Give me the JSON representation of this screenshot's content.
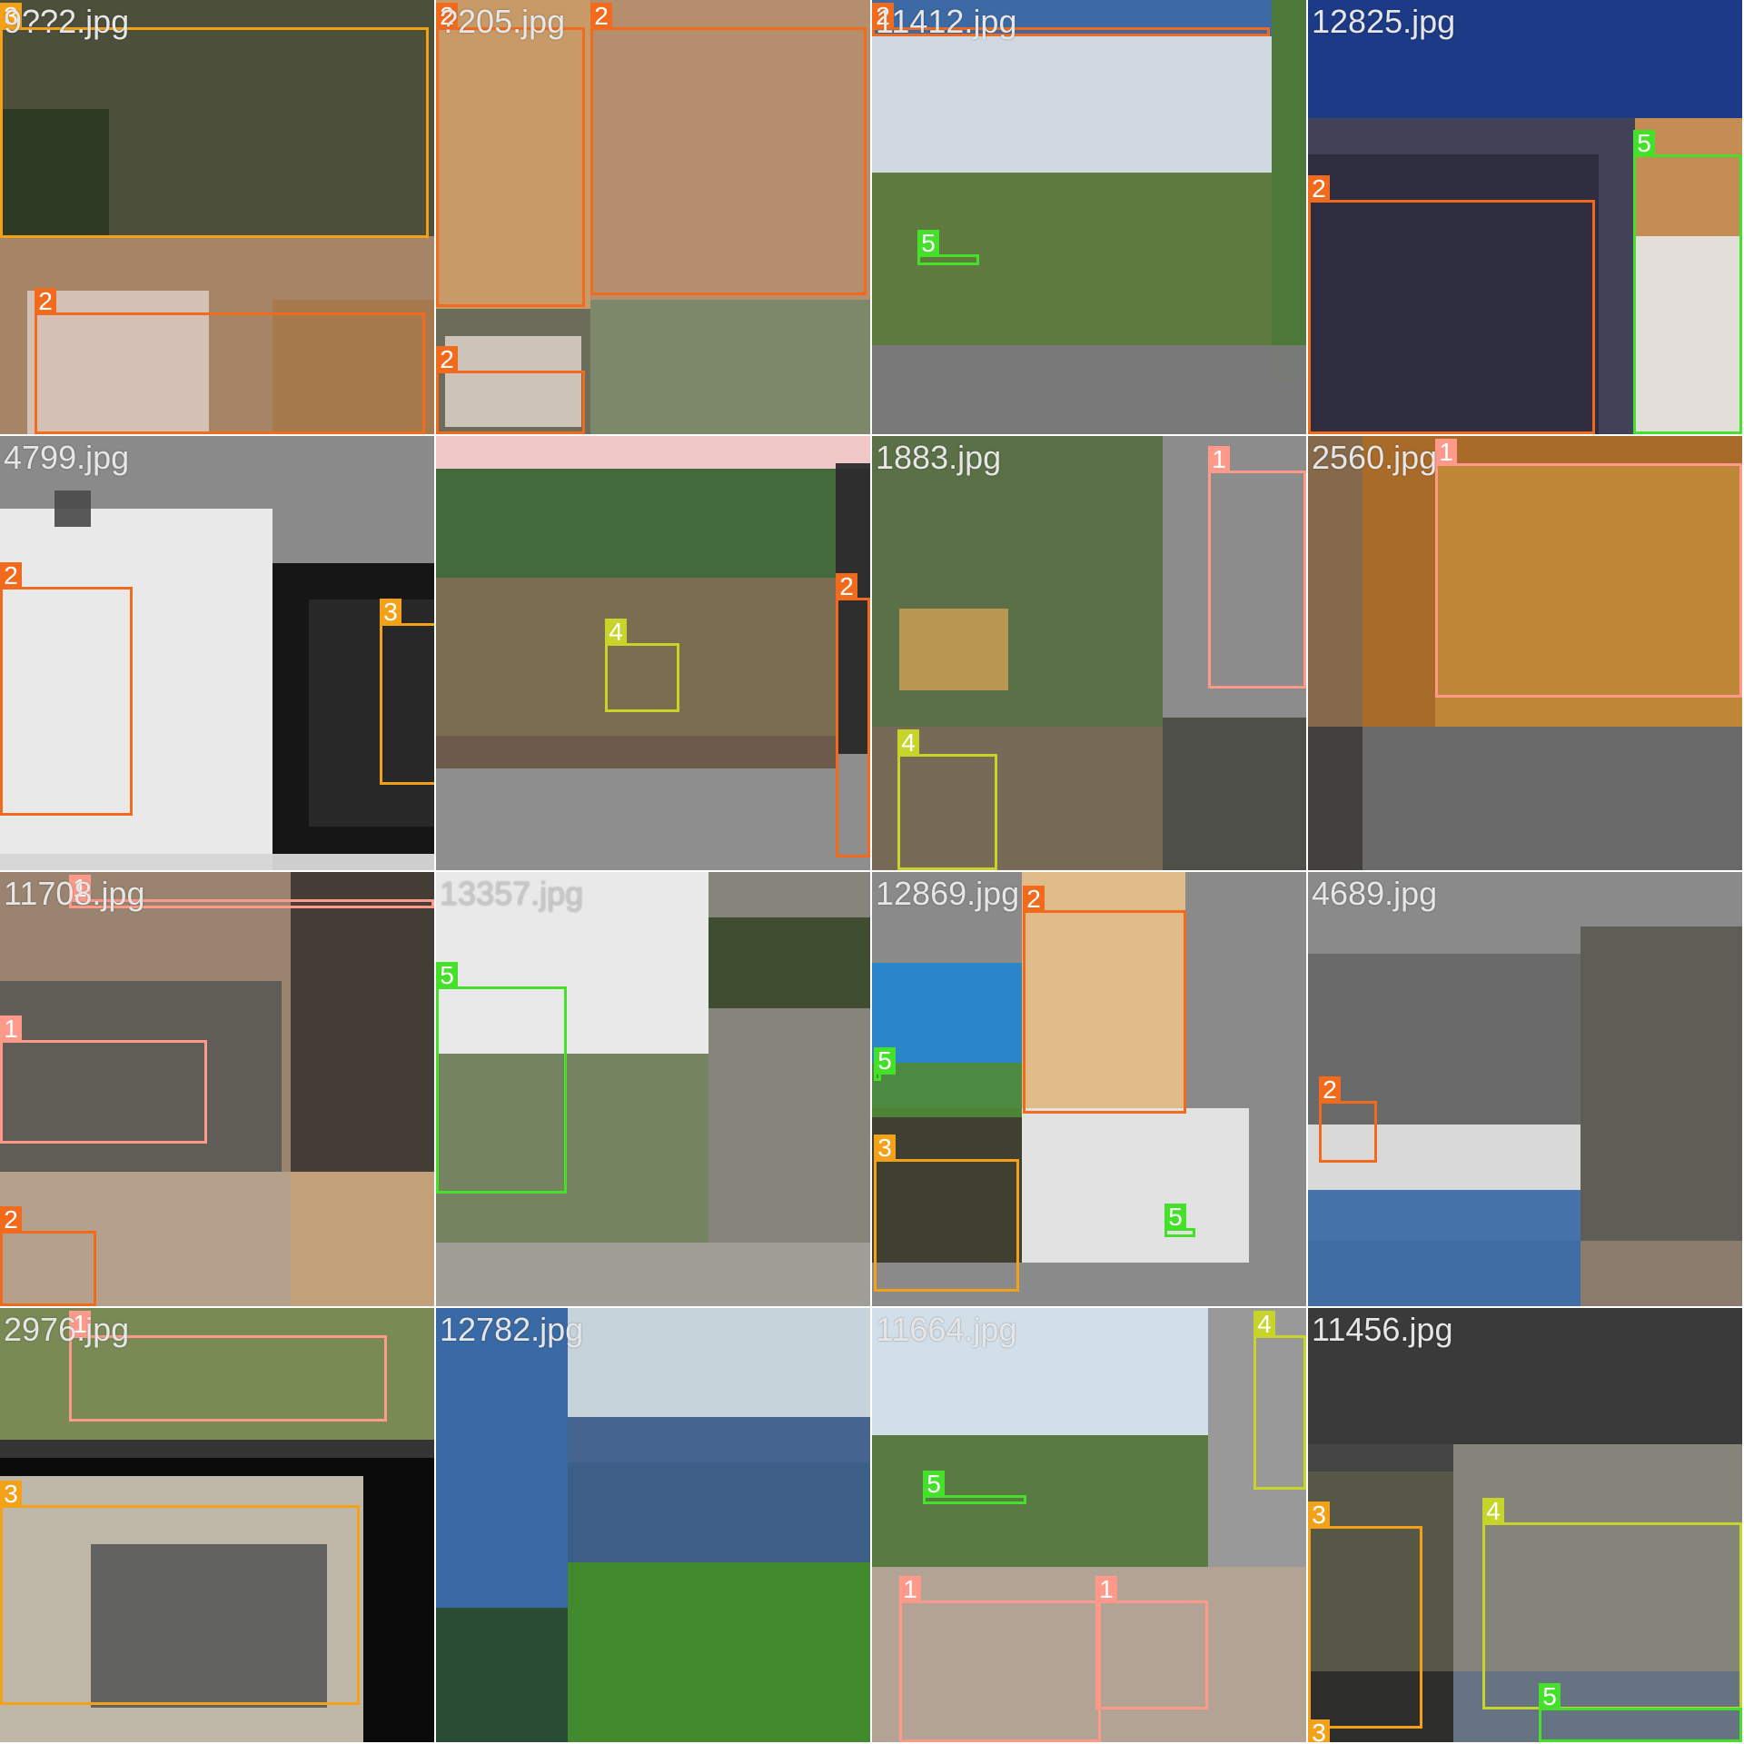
{
  "palette": {
    "class_1": "#ff9a8a",
    "class_2": "#f26b1d",
    "class_3": "#f4a11a",
    "class_4": "#c7d42a",
    "class_5": "#44e02a"
  },
  "tiles": [
    {
      "filename": "9??2.jpg",
      "bg": "#3b3a2f",
      "patches": [
        "#4c4f3a",
        "#b08b6b",
        "#2e3a24",
        "#d8c7bd",
        "#a77a4c"
      ],
      "boxes": [
        3,
        2
      ]
    },
    {
      "filename": "?205.jpg",
      "bg": "#8b7055",
      "patches": [
        "#c79a68",
        "#b99070",
        "#7c8a6d",
        "#6a6a5a",
        "#d7cbc1"
      ],
      "boxes": [
        2,
        2,
        2
      ]
    },
    {
      "filename": "11412.jpg",
      "bg": "#6d6d6d",
      "patches": [
        "#3d6aa5",
        "#d9e2ec",
        "#5f7d3d",
        "#4a7a35",
        "#7b7b7b"
      ],
      "boxes": [
        2,
        5
      ]
    },
    {
      "filename": "12825.jpg",
      "bg": "#9a9a9a",
      "patches": [
        "#1d3a86",
        "#3a3a52",
        "#c98c4e",
        "#e5e5e5",
        "#2c2c3e"
      ],
      "boxes": [
        2,
        5
      ]
    },
    {
      "filename": "4799.jpg",
      "bg": "#8a8a8a",
      "patches": [
        "#e9e9e9",
        "#0c0c0c",
        "#2a2a2a",
        "#d5d5d5",
        "#4b4b4b"
      ],
      "boxes": [
        2,
        3
      ]
    },
    {
      "filename": "",
      "bg": "#8e8e8e",
      "patches": [
        "#f0c8c8",
        "#7a6a4a",
        "#3e6a3a",
        "#6a5a4a",
        "#262626"
      ],
      "boxes": [
        4,
        2
      ]
    },
    {
      "filename": "1883.jpg",
      "bg": "#8a8a8a",
      "patches": [
        "#5a7046",
        "#8c8c8c",
        "#c19a55",
        "#7a6a5a",
        "#4a4a44"
      ],
      "boxes": [
        1,
        4
      ]
    },
    {
      "filename": "2560.jpg",
      "bg": "#5f5f5f",
      "patches": [
        "#a86b2a",
        "#8a6a4a",
        "#3e3e3e",
        "#6b6b6b",
        "#c08a3a"
      ],
      "boxes": [
        1
      ]
    },
    {
      "filename": "11708.jpg",
      "bg": "#7f6b5a",
      "patches": [
        "#9a8470",
        "#3e3a32",
        "#b9a58f",
        "#5a5a52",
        "#c39f78"
      ],
      "boxes": [
        1,
        2,
        1
      ]
    },
    {
      "filename": "13357.jpg",
      "bg": "#c9c9c9",
      "patches": [
        "#e9e9e9",
        "#7f7f75",
        "#6b7a55",
        "#3a4a2a",
        "#9a9a92"
      ],
      "boxes": [
        5
      ]
    },
    {
      "filename": "12869.jpg",
      "bg": "#8a8a8a",
      "patches": [
        "#2a86c9",
        "#e6c08a",
        "#3a3a2a",
        "#4f8a35",
        "#e9e9e9"
      ],
      "boxes": [
        2,
        5,
        3,
        5
      ]
    },
    {
      "filename": "4689.jpg",
      "bg": "#8a8a8a",
      "patches": [
        "#6a6a6a",
        "#e0e0e0",
        "#5a5a52",
        "#3a6aa5",
        "#8a7a6a"
      ],
      "boxes": [
        2
      ]
    },
    {
      "filename": "2976.jpg",
      "bg": "#0a0a0a",
      "patches": [
        "#7a8a55",
        "#0c0c0c",
        "#cfc7b5",
        "#3a3a3a",
        "#5a5a5a"
      ],
      "boxes": [
        1,
        3
      ]
    },
    {
      "filename": "12782.jpg",
      "bg": "#6a8a5a",
      "patches": [
        "#3a6aa5",
        "#cfd9e6",
        "#3a5a8a",
        "#3f8a2a",
        "#2a4a2a"
      ],
      "boxes": []
    },
    {
      "filename": "11664.jpg",
      "bg": "#8a8a8a",
      "patches": [
        "#4a7aa5",
        "#dde6ee",
        "#5a7a3a",
        "#9a9a9a",
        "#b5a595"
      ],
      "boxes": [
        4,
        5,
        1,
        1
      ]
    },
    {
      "filename": "11456.jpg",
      "bg": "#454545",
      "patches": [
        "#3a3a3a",
        "#8a8a80",
        "#5a5a4a",
        "#2a2a2a",
        "#6a7a8a"
      ],
      "boxes": [
        3,
        4,
        5,
        3
      ]
    }
  ]
}
